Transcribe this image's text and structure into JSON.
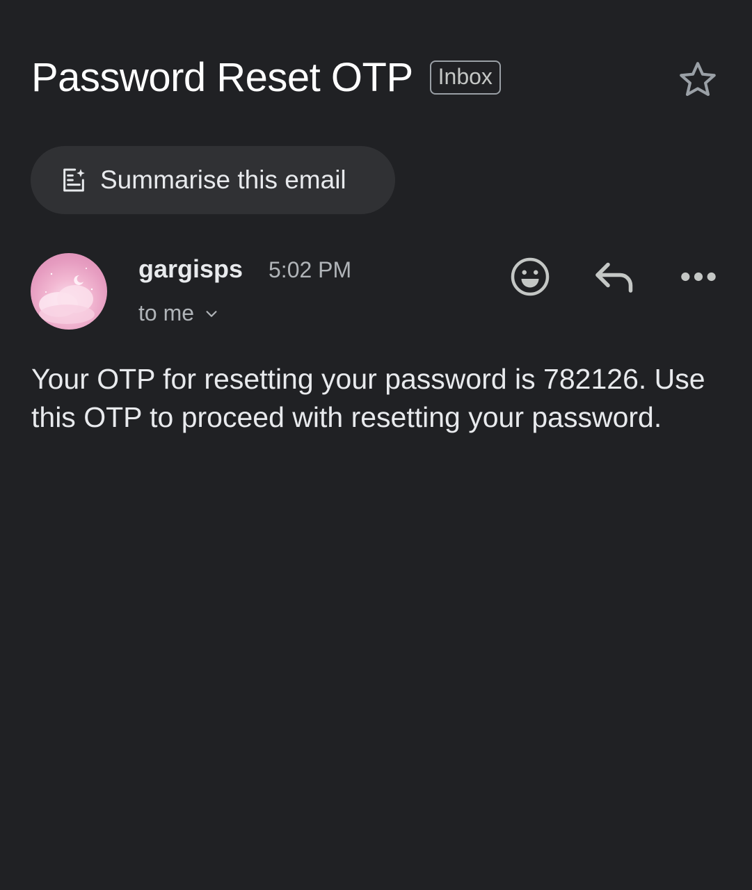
{
  "email": {
    "subject": "Password Reset OTP",
    "label": "Inbox",
    "summarise_label": "Summarise this email",
    "sender": "gargisps",
    "time": "5:02 PM",
    "recipients": "to me",
    "body": "Your OTP for resetting your password is 782126. Use this OTP to proceed with resetting your password."
  },
  "icons": {
    "star": "star-outline-icon",
    "summarise": "summarise-sparkle-icon",
    "emoji": "emoji-reaction-icon",
    "reply": "reply-icon",
    "more": "more-horizontal-icon",
    "chevron": "chevron-down-icon"
  },
  "colors": {
    "background": "#202124",
    "surface": "#303134",
    "text_primary": "#e8eaed",
    "text_secondary": "#b0b4b8",
    "avatar_pink": "#f2b8d2"
  }
}
